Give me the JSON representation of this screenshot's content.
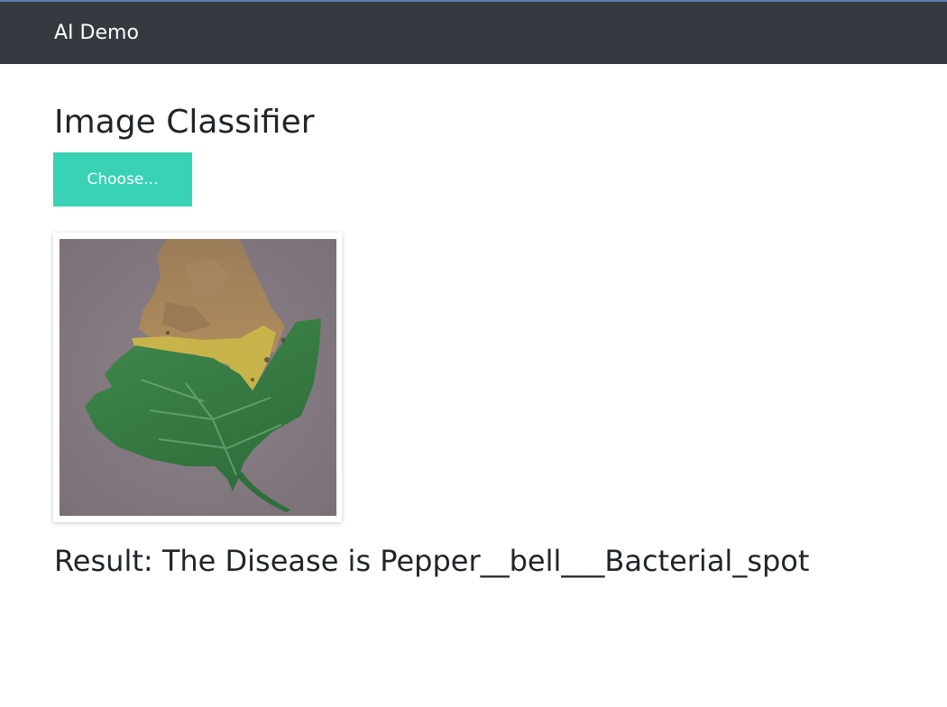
{
  "navbar": {
    "brand": "AI Demo",
    "background_color": "#343a40"
  },
  "main": {
    "title": "Image Classifier",
    "choose_button_label": "Choose...",
    "choose_button_color": "#39d2b4",
    "preview_image": "leaf-photo",
    "result_text": "Result: The Disease is Pepper__bell___Bacterial_spot"
  }
}
